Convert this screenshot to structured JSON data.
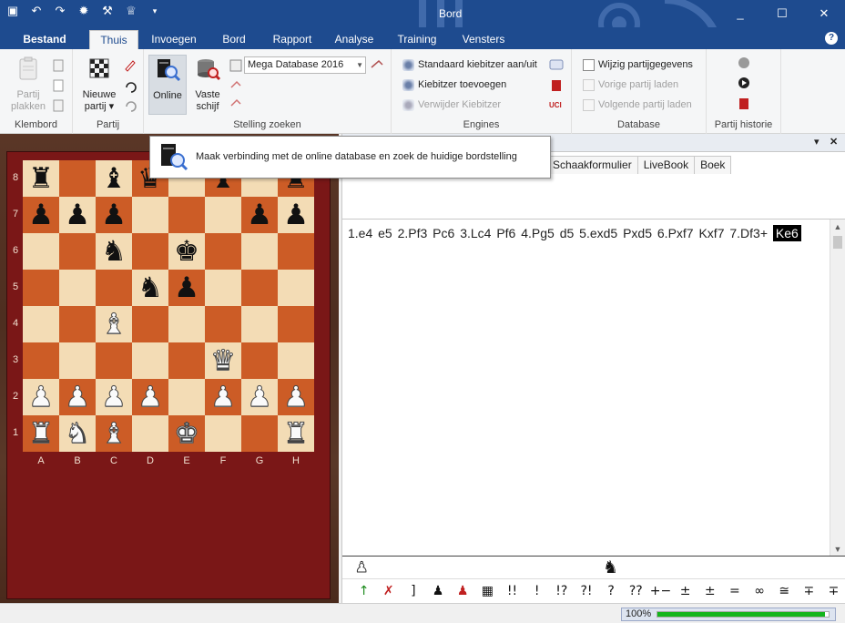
{
  "window": {
    "title": "Bord",
    "qat_icons": [
      "save-icon",
      "undo-icon",
      "redo-icon",
      "engine-icon",
      "tools-icon",
      "trophy-icon",
      "qat-customize-icon"
    ],
    "controls": [
      "_",
      "☐",
      "✕"
    ]
  },
  "ribbon": {
    "tabs": [
      {
        "label": "Bestand"
      },
      {
        "label": "Thuis",
        "active": true
      },
      {
        "label": "Invoegen"
      },
      {
        "label": "Bord"
      },
      {
        "label": "Rapport"
      },
      {
        "label": "Analyse"
      },
      {
        "label": "Training"
      },
      {
        "label": "Vensters"
      }
    ],
    "help_icon": "?",
    "groups": {
      "klembord": {
        "label": "Klembord",
        "paste_label_1": "Partij",
        "paste_label_2": "plakken"
      },
      "partij": {
        "label": "Partij",
        "new_label_1": "Nieuwe",
        "new_label_2": "partij ▾"
      },
      "stelling": {
        "label": "Stelling zoeken",
        "online_label": "Online",
        "disk_label_1": "Vaste",
        "disk_label_2": "schijf",
        "database_value": "Mega Database 2016"
      },
      "engines": {
        "label": "Engines",
        "items": [
          {
            "label": "Standaard kiebitzer aan/uit"
          },
          {
            "label": "Kiebitzer toevoegen"
          },
          {
            "label": "Verwijder Kiebitzer"
          }
        ]
      },
      "database": {
        "label": "Database",
        "items": [
          {
            "label": "Wijzig partijgegevens"
          },
          {
            "label": "Vorige partij laden"
          },
          {
            "label": "Volgende partij laden"
          }
        ]
      },
      "historie": {
        "label": "Partij historie"
      }
    }
  },
  "tooltip": {
    "text": "Maak verbinding met de online database en zoek de huidige bordstelling"
  },
  "board": {
    "files": [
      "A",
      "B",
      "C",
      "D",
      "E",
      "F",
      "G",
      "H"
    ],
    "ranks": [
      "8",
      "7",
      "6",
      "5",
      "4",
      "3",
      "2",
      "1"
    ],
    "pieces": [
      [
        "bR",
        "",
        "bB",
        "bQ",
        "",
        "bB",
        "",
        "bR"
      ],
      [
        "bP",
        "bP",
        "bP",
        "",
        "",
        "",
        "bP",
        "bP"
      ],
      [
        "",
        "",
        "bN",
        "",
        "bK",
        "",
        "",
        ""
      ],
      [
        "",
        "",
        "",
        "bN",
        "bP",
        "",
        "",
        ""
      ],
      [
        "",
        "",
        "wB",
        "",
        "",
        "",
        "",
        ""
      ],
      [
        "",
        "",
        "",
        "",
        "",
        "wQ",
        "",
        ""
      ],
      [
        "wP",
        "wP",
        "wP",
        "wP",
        "",
        "wP",
        "wP",
        "wP"
      ],
      [
        "wR",
        "wN",
        "wB",
        "",
        "wK",
        "",
        "",
        "wR"
      ]
    ]
  },
  "notation": {
    "header_controls": [
      "▾",
      "✕"
    ],
    "tabs": [
      "Schaakformulier",
      "LiveBook",
      "Boek"
    ],
    "moves_text": "1.e4  e5  2.Pf3  Pc6  3.Lc4  Pf6  4.Pg5  d5  5.exd5  Pxd5  6.Pxf7  Kxf7  7.Df3+",
    "current_move": "Ke6",
    "annotation_symbols": [
      "↑",
      "✗",
      "]",
      "♟",
      "♟",
      "▦",
      "!!",
      "!",
      "!?",
      "?!",
      "?",
      "??",
      "+−",
      "±",
      "±",
      "=",
      "∞",
      "≅",
      "∓",
      "∓"
    ]
  },
  "status": {
    "zoom": "100%",
    "progress": 0.98
  }
}
